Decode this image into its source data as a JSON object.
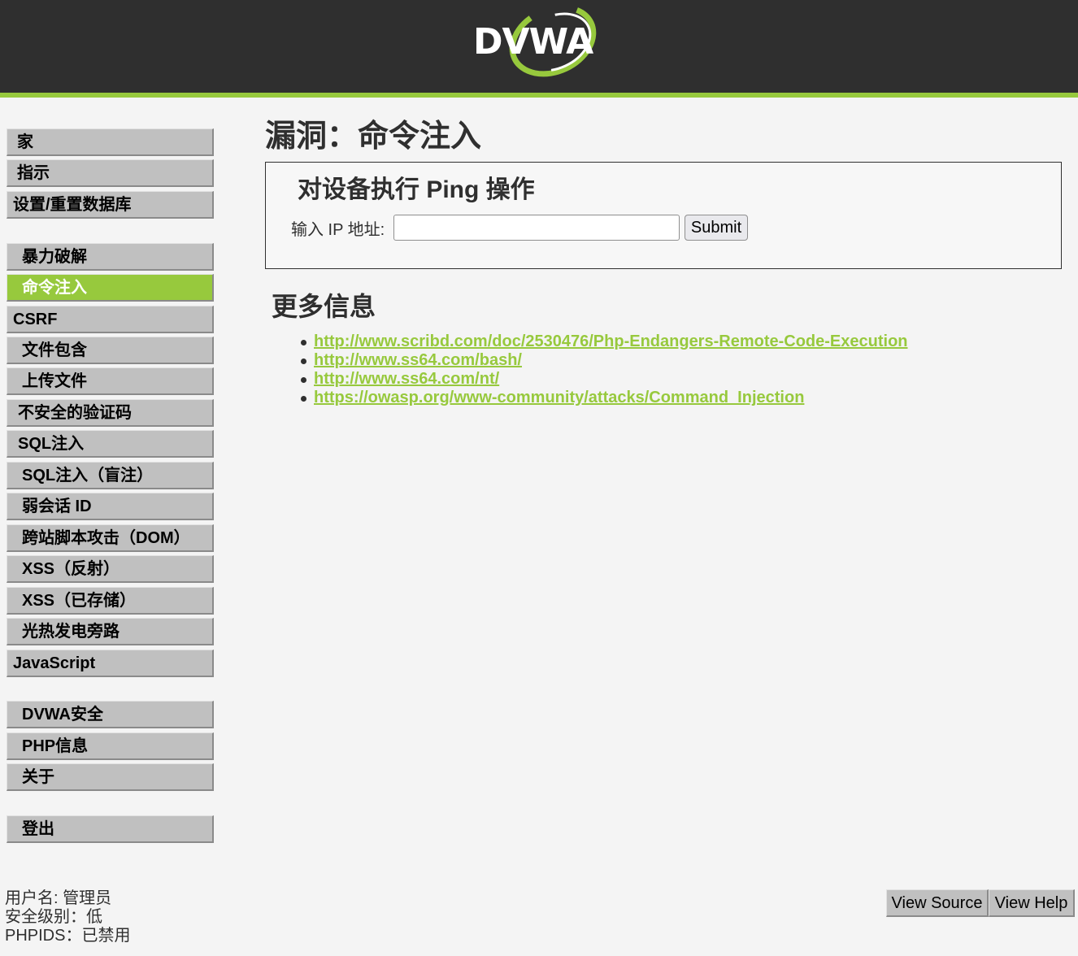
{
  "header": {
    "logo_text": "DVWA",
    "brand_color": "#97c93d",
    "background": "#2f2f2f"
  },
  "sidebar": {
    "items": [
      {
        "label": "家",
        "active": false
      },
      {
        "label": "指示",
        "active": false
      },
      {
        "label": "设置/重置数据库",
        "active": false
      },
      {
        "label": "暴力破解",
        "active": false
      },
      {
        "label": "命令注入",
        "active": true
      },
      {
        "label": "CSRF",
        "active": false
      },
      {
        "label": "文件包含",
        "active": false
      },
      {
        "label": "上传文件",
        "active": false
      },
      {
        "label": "不安全的验证码",
        "active": false
      },
      {
        "label": "SQL注入",
        "active": false
      },
      {
        "label": "SQL注入（盲注）",
        "active": false
      },
      {
        "label": "弱会话 ID",
        "active": false
      },
      {
        "label": "跨站脚本攻击（DOM）",
        "active": false
      },
      {
        "label": "XSS（反射）",
        "active": false
      },
      {
        "label": "XSS（已存储）",
        "active": false
      },
      {
        "label": "光热发电旁路",
        "active": false
      },
      {
        "label": "JavaScript",
        "active": false
      },
      {
        "label": "DVWA安全",
        "active": false
      },
      {
        "label": "PHP信息",
        "active": false
      },
      {
        "label": "关于",
        "active": false
      },
      {
        "label": "登出",
        "active": false
      }
    ]
  },
  "main": {
    "title": "漏洞：命令注入",
    "box_title": "对设备执行 Ping 操作",
    "ip_label": "输入 IP 地址:",
    "ip_value": "",
    "submit_label": "Submit",
    "more_info_title": "更多信息",
    "links": [
      "http://www.scribd.com/doc/2530476/Php-Endangers-Remote-Code-Execution",
      "http://www.ss64.com/bash/",
      "http://www.ss64.com/nt/",
      "https://owasp.org/www-community/attacks/Command_Injection"
    ]
  },
  "footer": {
    "username": "用户名:  管理员",
    "security_level": "安全级别：低",
    "phpids": "PHPIDS：已禁用",
    "view_source": "View Source",
    "view_help": "View Help"
  }
}
